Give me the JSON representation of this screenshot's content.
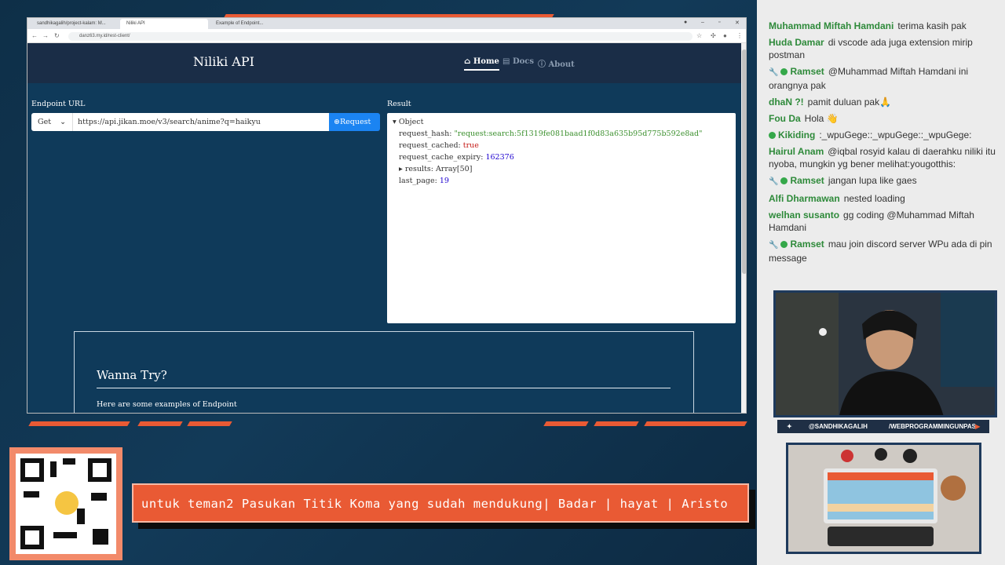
{
  "browser": {
    "tabs": [
      "sandhikagalih/project-kalam: M...",
      "Niliki API",
      "Example of Endpoint..."
    ],
    "url": "danz63.my.id/rest-client/"
  },
  "app": {
    "brand": "Niliki API",
    "nav": [
      "Home",
      "Docs",
      "About"
    ],
    "endpoint_label": "Endpoint URL",
    "method": "Get",
    "endpoint_value": "https://api.jikan.moe/v3/search/anime?q=haikyu",
    "request_button": "Request",
    "result_label": "Result",
    "result": {
      "root": "Object",
      "request_hash_key": "request_hash:",
      "request_hash_val": "\"request:search:5f1319fe081baad1f0d83a635b95d775b592e8ad\"",
      "request_cached_key": "request_cached:",
      "request_cached_val": "true",
      "request_cache_expiry_key": "request_cache_expiry:",
      "request_cache_expiry_val": "162376",
      "results_key": "results:",
      "results_val": "Array[50]",
      "last_page_key": "last_page:",
      "last_page_val": "19"
    },
    "wanna_title": "Wanna Try?",
    "wanna_sub": "Here are some examples of Endpoint"
  },
  "chat": [
    {
      "user": "Muhammad Miftah Hamdani",
      "text": "terima kasih pak",
      "mod": false
    },
    {
      "user": "Huda Damar",
      "text": "di vscode ada juga extension mirip postman",
      "mod": false
    },
    {
      "user": "Ramset",
      "text": "@Muhammad Miftah Hamdani ini orangnya pak",
      "mod": true
    },
    {
      "user": "dhaN ?!",
      "text": "pamit duluan pak🙏",
      "mod": false
    },
    {
      "user": "Fou Da",
      "text": "Hola 👋",
      "mod": false
    },
    {
      "user": "Kikiding",
      "text": ":_wpuGege::_wpuGege::_wpuGege:",
      "mod": false,
      "badge": true
    },
    {
      "user": "Hairul Anam",
      "text": "@iqbal rosyid kalau di daerahku niliki itu nyoba, mungkin yg bener melihat:yougotthis:",
      "mod": false
    },
    {
      "user": "Ramset",
      "text": "jangan lupa like gaes",
      "mod": true
    },
    {
      "user": "Alfi Dharmawan",
      "text": "nested loading",
      "mod": false
    },
    {
      "user": "welhan susanto",
      "text": "gg coding @Muhammad Miftah Hamdani",
      "mod": false
    },
    {
      "user": "Ramset",
      "text": "mau join discord server WPu ada di pin message",
      "mod": true
    }
  ],
  "overlay": {
    "handle_left": "@SANDHIKAGALIH",
    "handle_right": "/WEBPROGRAMMINGUNPAS",
    "ticker": "untuk teman2 Pasukan Titik Koma yang sudah mendukung| Badar | hayat | Aristo"
  },
  "colors": {
    "accent": "#e95a34",
    "nav_bg": "#1a2d47",
    "app_bg": "#0f3a5a",
    "request_btn": "#1b84f2"
  }
}
